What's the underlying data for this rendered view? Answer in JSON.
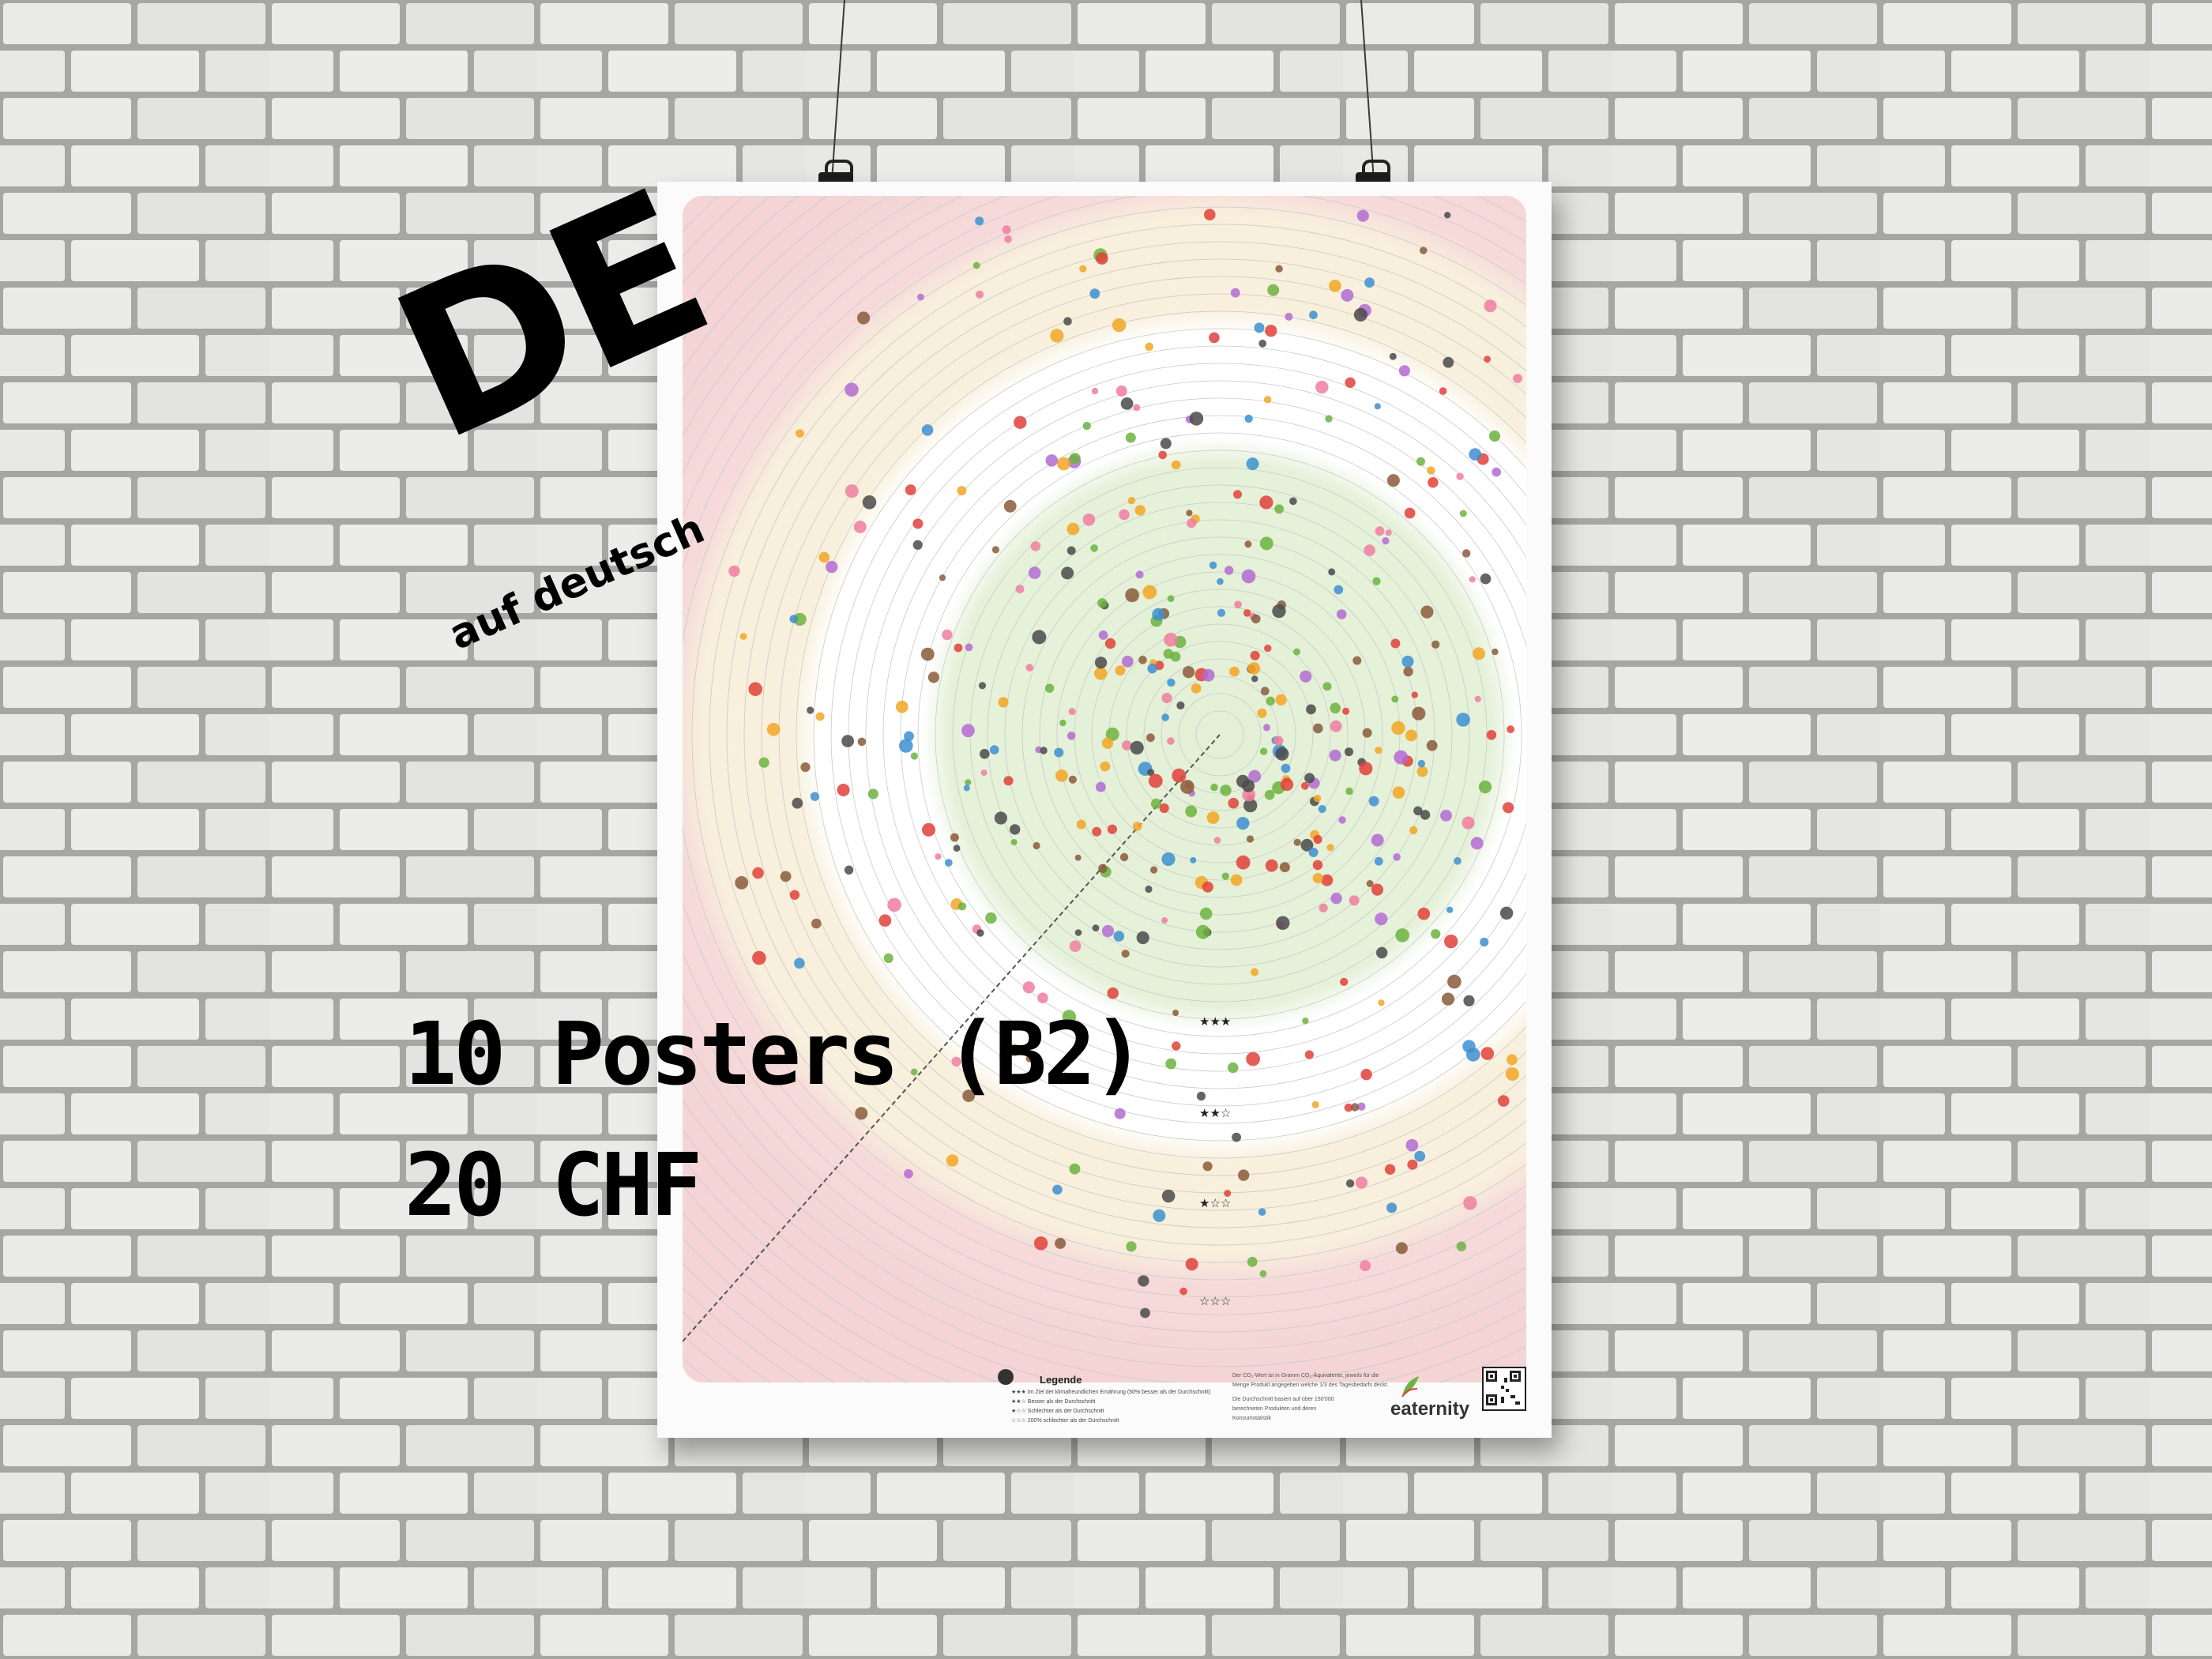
{
  "overlay": {
    "language_code": "DE",
    "language_label": "auf deutsch",
    "offer_line1": "10 Posters (B2)",
    "offer_line2": "20 CHF"
  },
  "poster": {
    "legend_title": "Legende",
    "legend_items": [
      "★★★ Im Ziel der klimafreundlichen Ernährung (50% besser als der Durchschnitt)",
      "★★☆ Besser als der Durchschnitt",
      "★☆☆ Schlechter als der Durchschnitt",
      "☆☆☆ 200% schlechter als der Durchschnitt"
    ],
    "notes": [
      "Der CO₂-Wert ist in Gramm CO₂-Äquivalente, jeweils für die",
      "Menge Produkt angegeben welche 1/3 des Tagesbedarfs deckt.",
      "Die Durchschnitt basiert auf über 150'000",
      "berechneten Produkten und deren",
      "Konsumstatistik"
    ],
    "brand": "eaternity",
    "ratings": [
      "★★★",
      "★★☆",
      "★☆☆",
      "☆☆☆"
    ]
  },
  "colors": {
    "ring_red": "#f6d9d9",
    "ring_yellow": "#f8f0dc",
    "ring_white": "#ffffff",
    "ring_green": "#e8f3dc",
    "brand_green": "#6cb33f",
    "brand_red": "#e0413a"
  }
}
